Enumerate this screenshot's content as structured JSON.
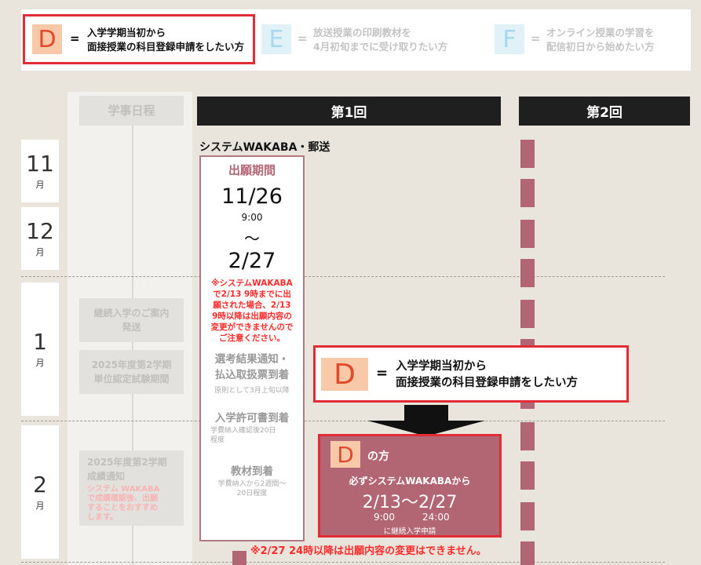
{
  "legend": {
    "d": {
      "letter": "D",
      "eq": "=",
      "line1": "入学学期当初から",
      "line2": "面接授業の科目登録申請をしたい方"
    },
    "e": {
      "letter": "E",
      "eq": "=",
      "line1": "放送授業の印刷教材を",
      "line2": "4月初旬までに受け取りたい方"
    },
    "f": {
      "letter": "F",
      "eq": "=",
      "line1": "オンライン授業の学習を",
      "line2": "配信初日から始めたい方"
    }
  },
  "columns": {
    "schedule": "学事日程",
    "round1": "第1回",
    "round2": "第2回"
  },
  "months": [
    {
      "num": "11",
      "unit": "月"
    },
    {
      "num": "12",
      "unit": "月"
    },
    {
      "num": "1",
      "unit": "月"
    },
    {
      "num": "2",
      "unit": "月"
    }
  ],
  "schedule_items": {
    "item1": [
      "継続入学のご案内",
      "発送"
    ],
    "item2": [
      "2025年度第2学期",
      "単位認定試験期間"
    ],
    "item3": [
      "2025年度第2学期",
      "成績通知"
    ],
    "item3_note": [
      "システム WAKABA",
      "で成績確認後、出願",
      "することをおすすめ",
      "します。"
    ]
  },
  "round1": {
    "method": "システムWAKABA・郵送",
    "period_title": "出願期間",
    "start_date": "11/26",
    "start_time": "9:00",
    "tilde": "〜",
    "end_date": "2/27",
    "note": [
      "※システムWAKABA",
      "で2/13 9時までに出",
      "願された場合、2/13",
      "9時以降は出願内容の",
      "変更ができませんので",
      "ご注意ください。"
    ],
    "result_title": [
      "選考結果通知・",
      "払込取扱票到着"
    ],
    "result_sub": "原則として3月上旬以降",
    "permit_title": "入学許可書到着",
    "permit_sub": [
      "学費納入確認後20日",
      "程度"
    ],
    "material_title": "教材到着",
    "material_sub": [
      "学費納入から2週間〜",
      "20日程度"
    ]
  },
  "callout": {
    "letter": "D",
    "eq": "=",
    "line1": "入学学期当初から",
    "line2": "面接授業の科目登録申請をしたい方"
  },
  "d_window": {
    "letter": "D",
    "suffix": "の方",
    "line1": "必ずシステムWAKABAから",
    "dates": "2/13〜2/27",
    "time_start": "9:00",
    "time_end": "24:00",
    "note": "に継続入学申請"
  },
  "bottom_note": "※2/27 24時以降は出願内容の変更はできません。",
  "colors": {
    "d_box": "#f7c9a8",
    "d_letter": "#e24a2c",
    "ef_box": "#e1f1f8",
    "ef_letter": "#a8d8ec",
    "highlight_red": "#e22d36",
    "pink": "#b26572",
    "header_black": "#1f1f1f"
  }
}
